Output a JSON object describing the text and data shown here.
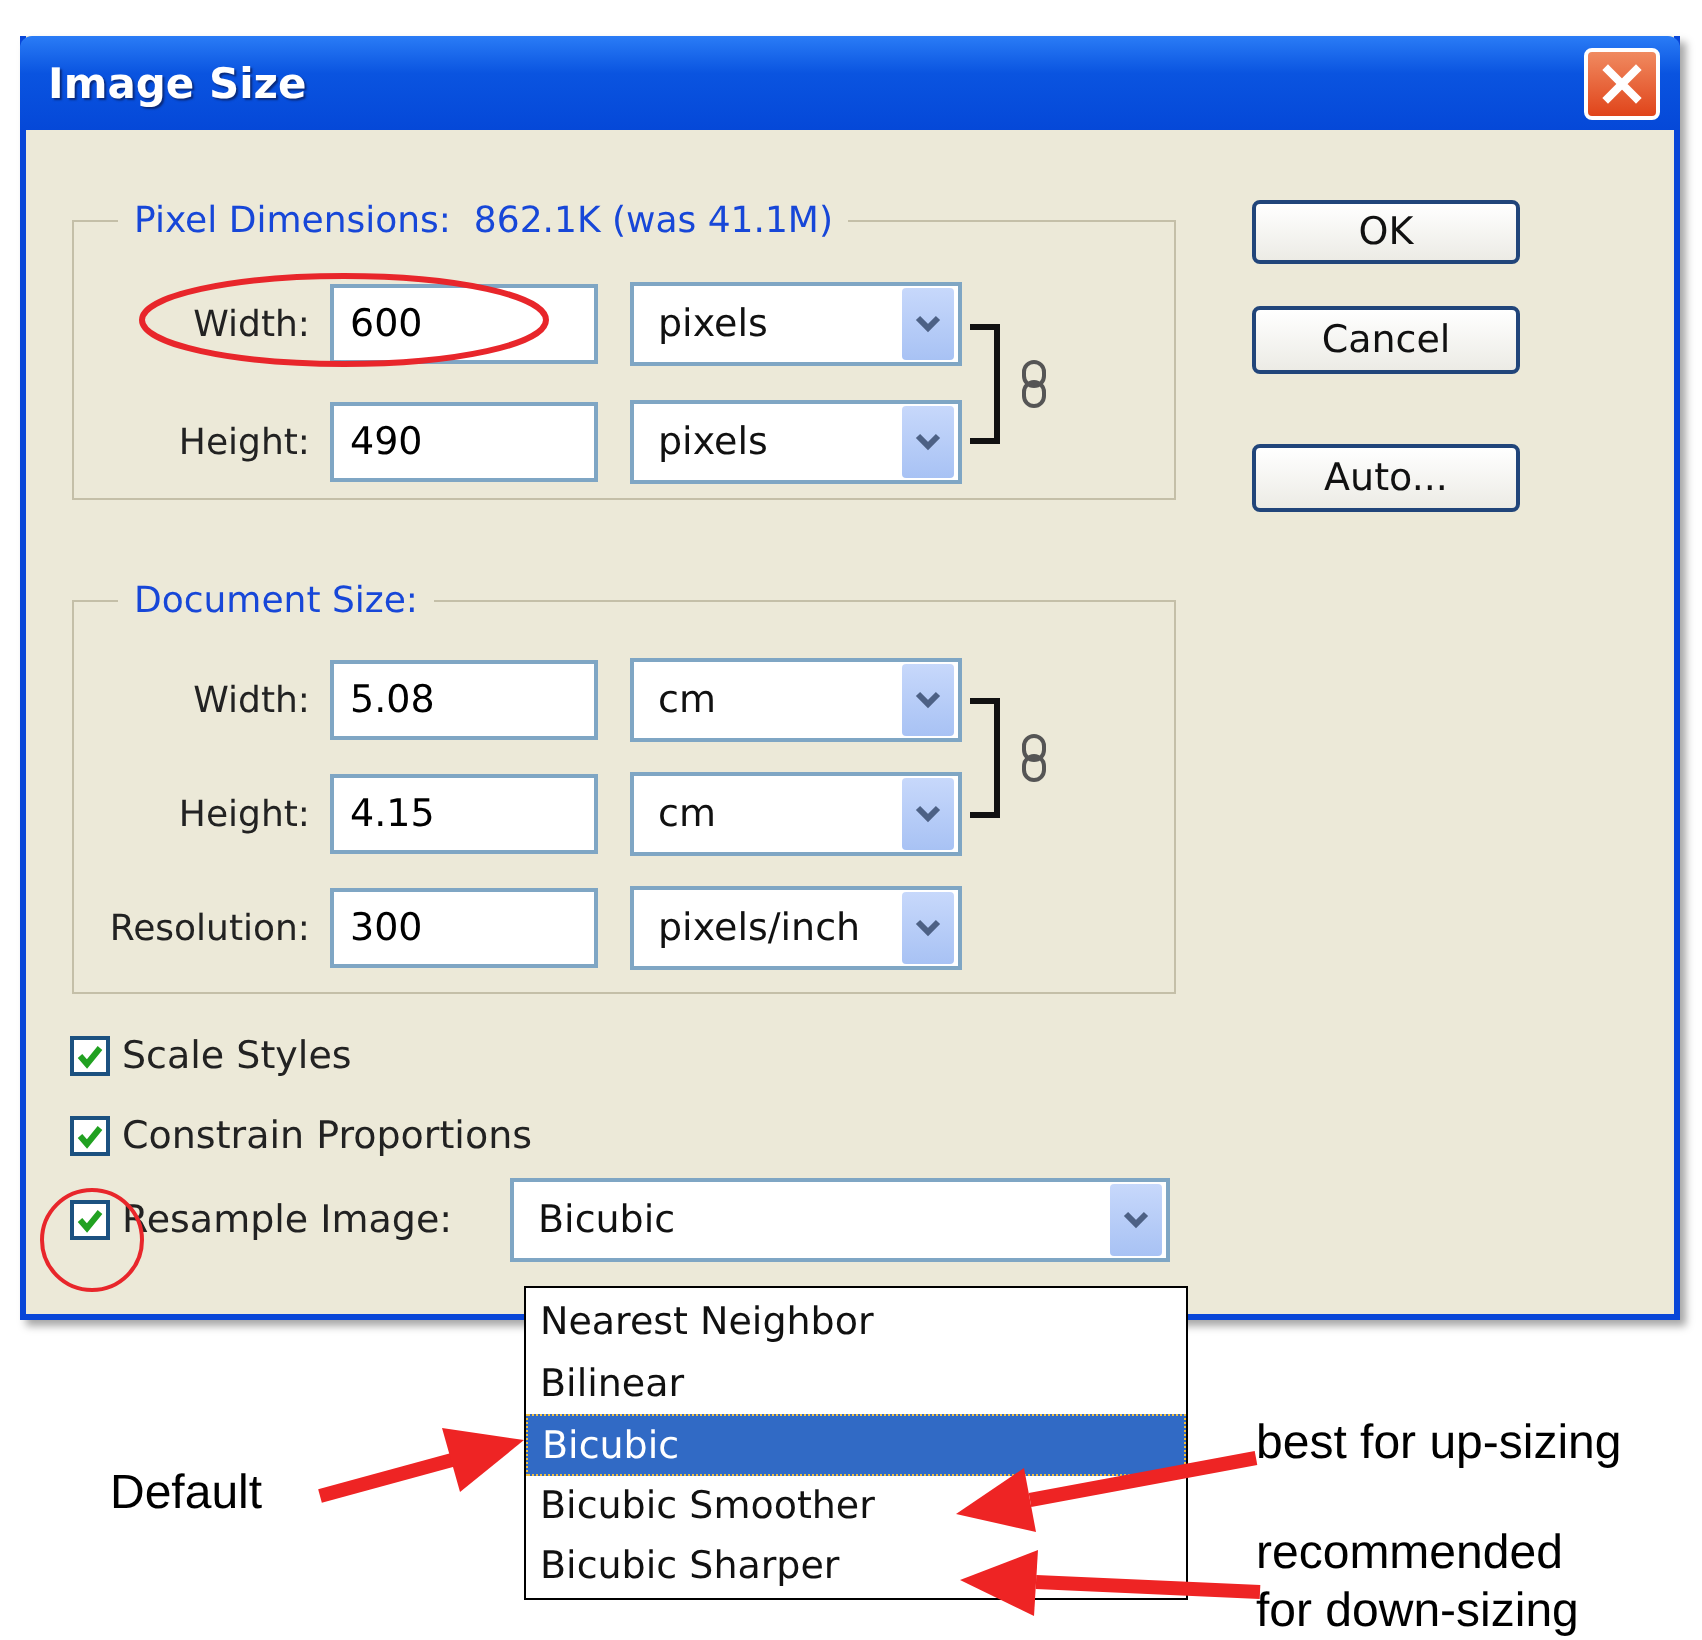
{
  "window": {
    "title": "Image Size"
  },
  "pixel_dimensions": {
    "title": "Pixel Dimensions:",
    "summary": "862.1K (was 41.1M)",
    "fields": [
      {
        "label": "Width:",
        "value": "600",
        "unit": "pixels"
      },
      {
        "label": "Height:",
        "value": "490",
        "unit": "pixels"
      }
    ]
  },
  "document_size": {
    "title": "Document Size:",
    "fields": [
      {
        "label": "Width:",
        "value": "5.08",
        "unit": "cm"
      },
      {
        "label": "Height:",
        "value": "4.15",
        "unit": "cm"
      },
      {
        "label": "Resolution:",
        "value": "300",
        "unit": "pixels/inch"
      }
    ]
  },
  "buttons": [
    "OK",
    "Cancel",
    "Auto..."
  ],
  "options": [
    {
      "label": "Scale Styles",
      "checked": true
    },
    {
      "label": "Constrain Proportions",
      "checked": true
    }
  ],
  "resample": {
    "label": "Resample Image:",
    "checked": true,
    "value": "Bicubic",
    "options": [
      {
        "label": "Nearest Neighbor",
        "selected": false
      },
      {
        "label": "Bilinear",
        "selected": false
      },
      {
        "label": "Bicubic",
        "selected": true
      },
      {
        "label": "Bicubic Smoother",
        "selected": false
      },
      {
        "label": "Bicubic Sharper",
        "selected": false
      }
    ]
  },
  "annotations": [
    {
      "text": "Default"
    },
    {
      "text": "best for up-sizing"
    },
    {
      "text": "recommended\nfor down-sizing"
    }
  ]
}
